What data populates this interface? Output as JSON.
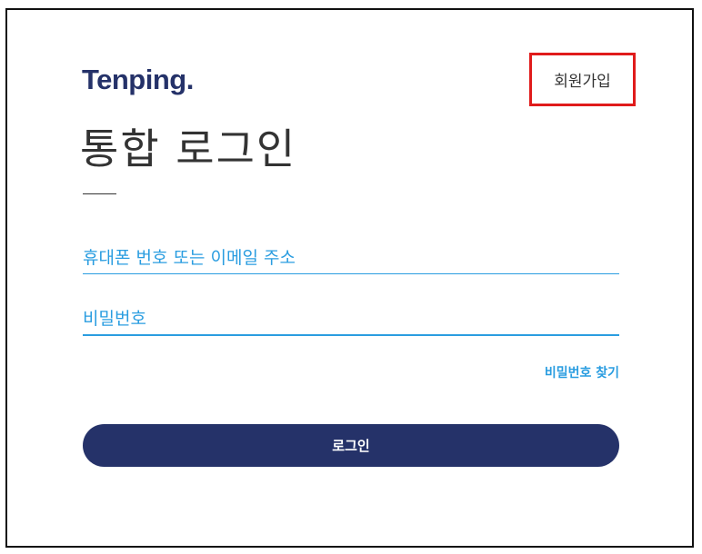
{
  "brand": {
    "logo_text": "Tenping."
  },
  "header": {
    "signup_label": "회원가입"
  },
  "page": {
    "title": "통합 로그인"
  },
  "form": {
    "phone_email_placeholder": "휴대폰 번호 또는 이메일 주소",
    "password_placeholder": "비밀번호",
    "forgot_password_label": "비밀번호 찾기",
    "login_button_label": "로그인"
  },
  "colors": {
    "brand_navy": "#253269",
    "accent_blue": "#2a9de0",
    "highlight_red": "#e01b1b"
  }
}
